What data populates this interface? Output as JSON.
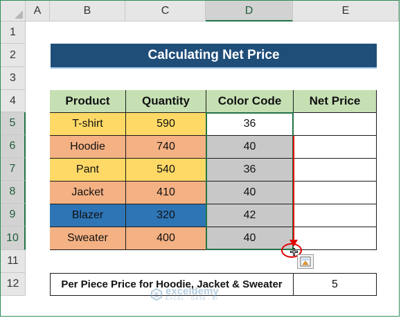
{
  "columns": [
    "A",
    "B",
    "C",
    "D",
    "E"
  ],
  "rows": [
    "1",
    "2",
    "3",
    "4",
    "5",
    "6",
    "7",
    "8",
    "9",
    "10",
    "11",
    "12"
  ],
  "title": "Calculating Net Price",
  "table": {
    "headers": [
      "Product",
      "Quantity",
      "Color Code",
      "Net Price"
    ],
    "rows": [
      {
        "product": "T-shirt",
        "quantity": "590",
        "color_code": "36",
        "net_price": "",
        "color": "yellow"
      },
      {
        "product": "Hoodie",
        "quantity": "740",
        "color_code": "40",
        "net_price": "",
        "color": "orange"
      },
      {
        "product": "Pant",
        "quantity": "540",
        "color_code": "36",
        "net_price": "",
        "color": "yellow"
      },
      {
        "product": "Jacket",
        "quantity": "410",
        "color_code": "40",
        "net_price": "",
        "color": "orange"
      },
      {
        "product": "Blazer",
        "quantity": "320",
        "color_code": "42",
        "net_price": "",
        "color": "blue"
      },
      {
        "product": "Sweater",
        "quantity": "400",
        "color_code": "40",
        "net_price": "",
        "color": "orange"
      }
    ]
  },
  "per_piece": {
    "label": "Per Piece Price for Hoodie, Jacket & Sweater",
    "value": "5"
  },
  "watermark": {
    "name": "exceldemy",
    "tagline": "EXCEL · DATA · BI"
  },
  "icons": {
    "fill_handle": "crosshair-icon",
    "autofill": "auto-fill-options-icon",
    "drag_arrow": "arrow-down-icon",
    "watermark": "exceldemy-logo-icon"
  },
  "colors": {
    "title_bg": "#1f4e79",
    "header_bg": "#c6e0b4",
    "yellow": "#ffd966",
    "orange": "#f4b183",
    "blue": "#2e75b6",
    "gray": "#c8c8c8",
    "selection": "#217346",
    "arrow": "#e00000"
  }
}
